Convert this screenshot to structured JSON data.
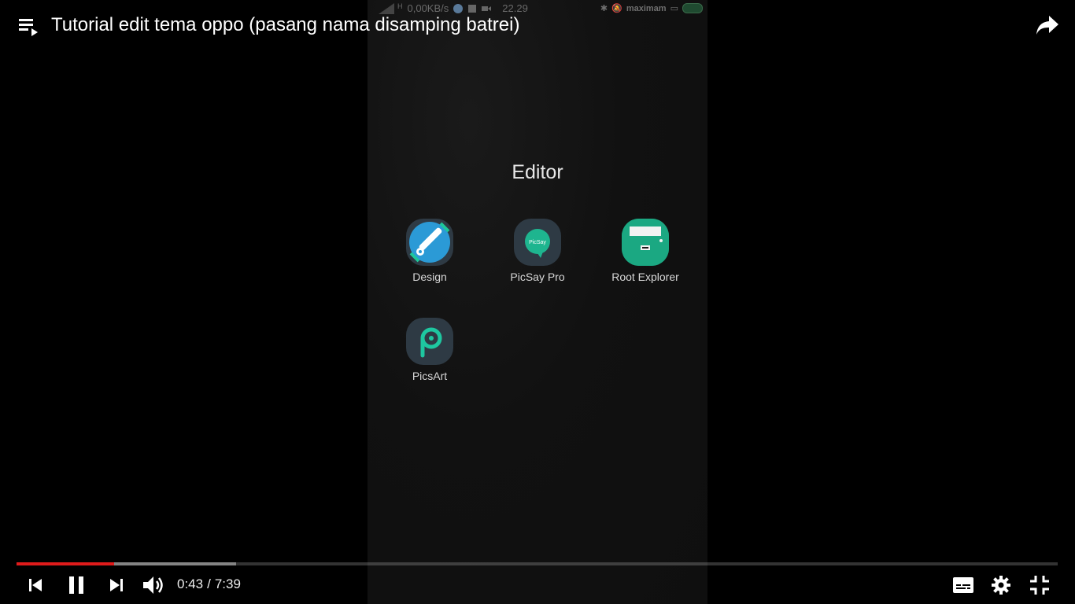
{
  "player": {
    "title": "Tutorial edit tema oppo (pasang nama disamping batrei)",
    "current_time": "0:43",
    "separator": "/",
    "duration": "7:39",
    "progress_played_fraction": 0.094,
    "progress_buffered_fraction": 0.211,
    "accent_color": "#e01b1b"
  },
  "phone": {
    "status": {
      "net_type": "H",
      "speed": "0,00KB/s",
      "time": "22.29",
      "carrier": "maximam"
    },
    "folder_title": "Editor",
    "apps": [
      {
        "label": "Design",
        "icon": "design-pen-icon"
      },
      {
        "label": "PicSay Pro",
        "icon": "picsay-bubble-icon"
      },
      {
        "label": "Root Explorer",
        "icon": "root-explorer-icon"
      },
      {
        "label": "PicsArt",
        "icon": "picsart-p-icon"
      }
    ],
    "picsay_icon_text": "PicSay"
  }
}
